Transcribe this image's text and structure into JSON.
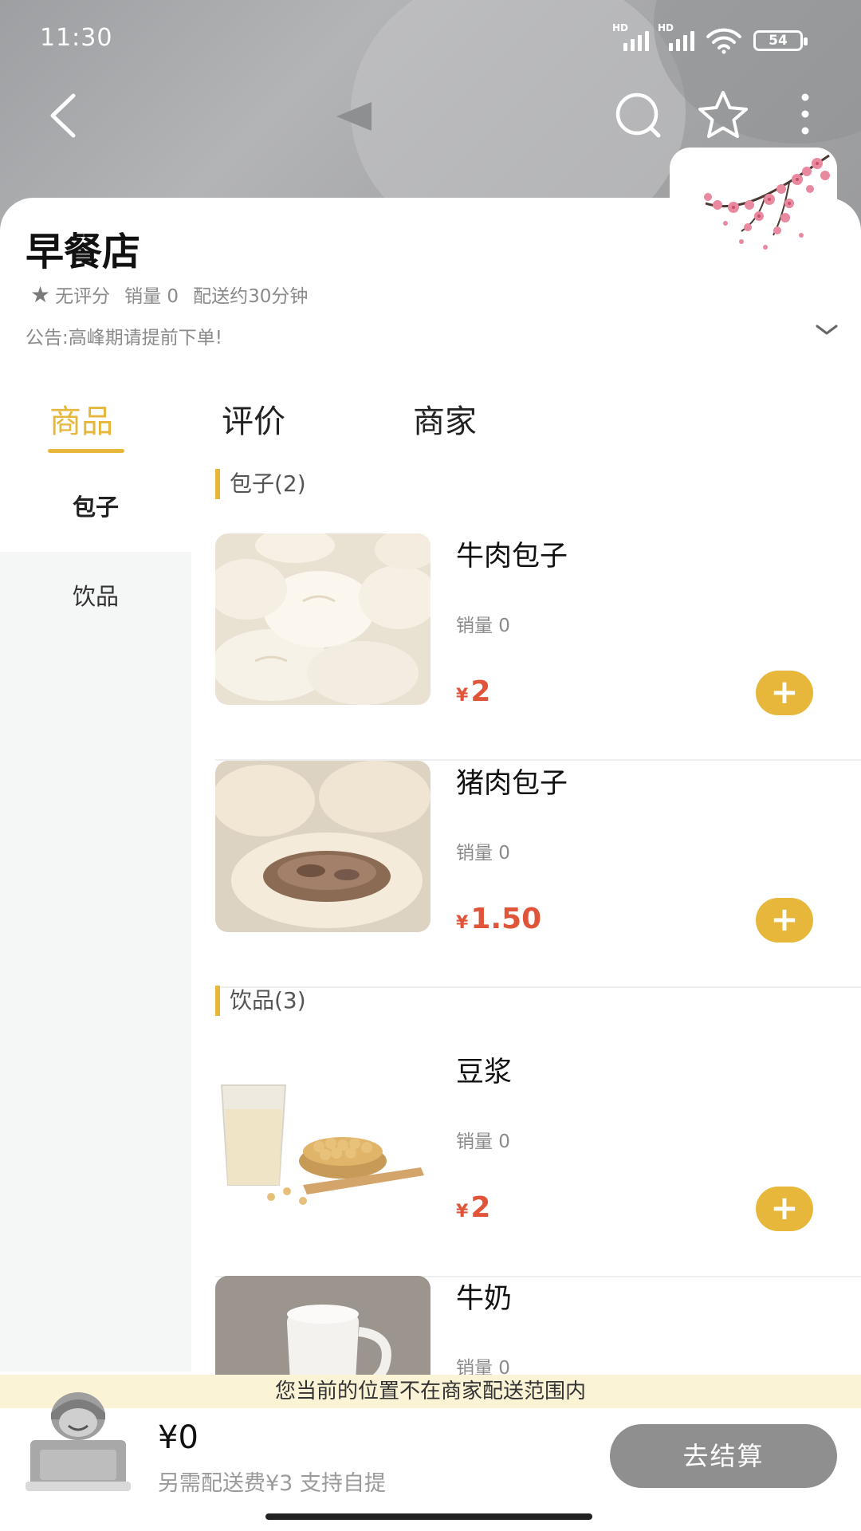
{
  "status_bar": {
    "time": "11:30",
    "network_1": "HD",
    "network_2": "HD",
    "battery": "54"
  },
  "nav": {
    "back_icon": "chevron-left-icon",
    "search_icon": "search-icon",
    "favorite_icon": "star-outline-icon",
    "more_icon": "more-vertical-icon"
  },
  "shop": {
    "name": "早餐店",
    "rating": "无评分",
    "sales": "销量 0",
    "delivery_time": "配送约30分钟",
    "notice": "公告:高峰期请提前下单!"
  },
  "tabs": [
    {
      "label": "商品"
    },
    {
      "label": "评价"
    },
    {
      "label": "商家"
    }
  ],
  "sidebar": {
    "items": [
      {
        "label": "包子"
      },
      {
        "label": "饮品"
      }
    ]
  },
  "sections": [
    {
      "title": "包子(2)",
      "products": [
        {
          "name": "牛肉包子",
          "sales": "销量 0",
          "currency": "¥",
          "price": "2"
        },
        {
          "name": "猪肉包子",
          "sales": "销量 0",
          "currency": "¥",
          "price": "1.50"
        }
      ]
    },
    {
      "title": "饮品(3)",
      "products": [
        {
          "name": "豆浆",
          "sales": "销量 0",
          "currency": "¥",
          "price": "2"
        },
        {
          "name": "牛奶",
          "sales": "销量 0"
        }
      ]
    }
  ],
  "add_button_label": "+",
  "warning": "您当前的位置不在商家配送范围内",
  "cart": {
    "total": "¥0",
    "fee_note": "另需配送费¥3 支持自提",
    "checkout_label": "去结算"
  },
  "colors": {
    "accent": "#e6b73a",
    "price": "#e0553a",
    "checkout_disabled": "#8f8f8f",
    "warning_bg": "#fbf3d6"
  }
}
